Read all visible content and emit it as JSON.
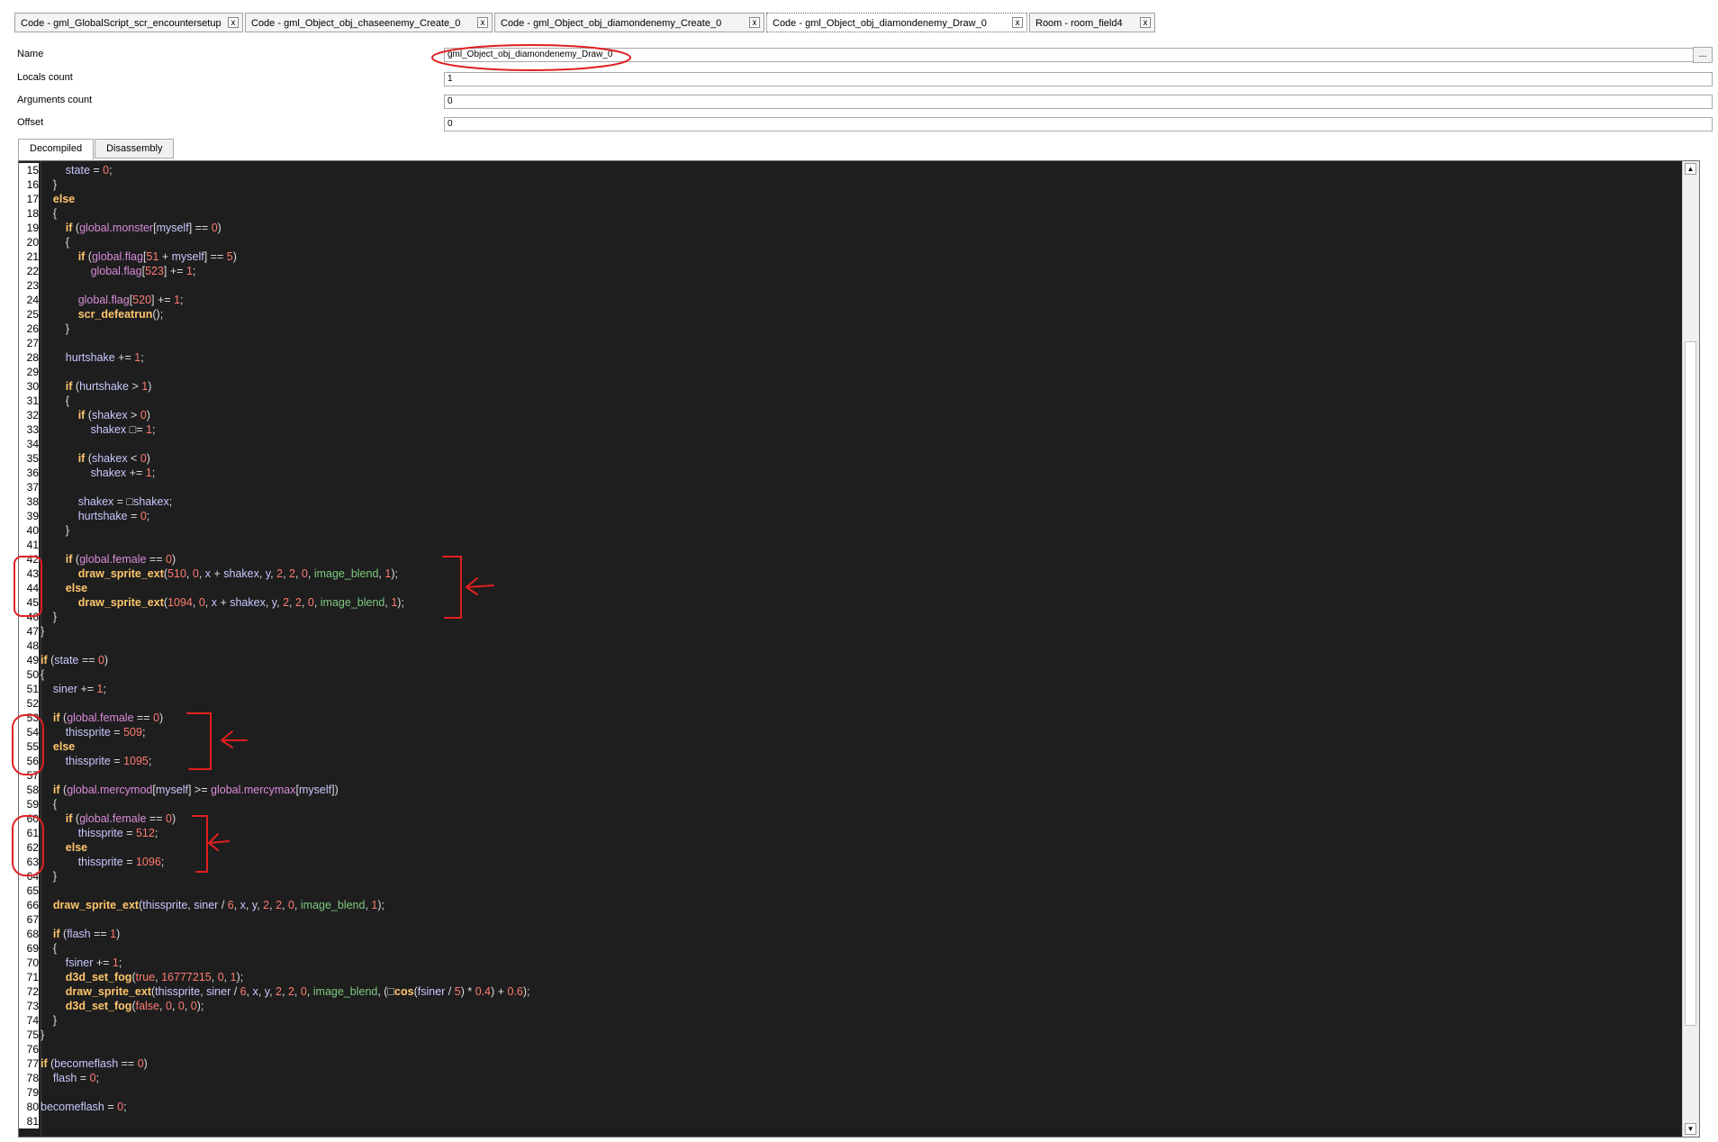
{
  "tabs": [
    {
      "label": "Code - gml_GlobalScript_scr_encountersetup",
      "close": "x",
      "width": 254
    },
    {
      "label": "Code - gml_Object_obj_chaseenemy_Create_0",
      "close": "x",
      "width": 275
    },
    {
      "label": "Code - gml_Object_obj_diamondenemy_Create_0",
      "close": "x",
      "width": 300
    },
    {
      "label": "Code - gml_Object_obj_diamondenemy_Draw_0",
      "close": "x",
      "width": 290,
      "active": true
    },
    {
      "label": "Room - room_field4",
      "close": "x",
      "width": 140
    }
  ],
  "properties": {
    "name_label": "Name",
    "name_value": "gml_Object_obj_diamondenemy_Draw_0",
    "browse_label": "...",
    "locals_label": "Locals count",
    "locals_value": "1",
    "arguments_label": "Arguments count",
    "arguments_value": "0",
    "offset_label": "Offset",
    "offset_value": "0"
  },
  "view_tabs": {
    "decompiled": "Decompiled",
    "disassembly": "Disassembly"
  },
  "code": {
    "lines": [
      {
        "n": "15",
        "html": "        <span class='id'>state</span> = <span class='num'>0</span>;"
      },
      {
        "n": "16",
        "html": "    }"
      },
      {
        "n": "17",
        "html": "    <span class='kw'>else</span>"
      },
      {
        "n": "18",
        "html": "    {"
      },
      {
        "n": "19",
        "html": "        <span class='kw'>if</span> (<span class='gv'>global.monster</span>[<span class='id'>myself</span>] == <span class='num'>0</span>)"
      },
      {
        "n": "20",
        "html": "        {"
      },
      {
        "n": "21",
        "html": "            <span class='kw'>if</span> (<span class='gv'>global.flag</span>[<span class='num'>51</span> + <span class='id'>myself</span>] == <span class='num'>5</span>)"
      },
      {
        "n": "22",
        "html": "                <span class='gv'>global.flag</span>[<span class='num'>523</span>] += <span class='num'>1</span>;"
      },
      {
        "n": "23",
        "html": ""
      },
      {
        "n": "24",
        "html": "            <span class='gv'>global.flag</span>[<span class='num'>520</span>] += <span class='num'>1</span>;"
      },
      {
        "n": "25",
        "html": "            <span class='fn'>scr_defeatrun</span>();"
      },
      {
        "n": "26",
        "html": "        }"
      },
      {
        "n": "27",
        "html": ""
      },
      {
        "n": "28",
        "html": "        <span class='id'>hurtshake</span> += <span class='num'>1</span>;"
      },
      {
        "n": "29",
        "html": ""
      },
      {
        "n": "30",
        "html": "        <span class='kw'>if</span> (<span class='id'>hurtshake</span> > <span class='num'>1</span>)"
      },
      {
        "n": "31",
        "html": "        {"
      },
      {
        "n": "32",
        "html": "            <span class='kw'>if</span> (<span class='id'>shakex</span> > <span class='num'>0</span>)"
      },
      {
        "n": "33",
        "html": "                <span class='id'>shakex</span> □= <span class='num'>1</span>;"
      },
      {
        "n": "34",
        "html": ""
      },
      {
        "n": "35",
        "html": "            <span class='kw'>if</span> (<span class='id'>shakex</span> < <span class='num'>0</span>)"
      },
      {
        "n": "36",
        "html": "                <span class='id'>shakex</span> += <span class='num'>1</span>;"
      },
      {
        "n": "37",
        "html": ""
      },
      {
        "n": "38",
        "html": "            <span class='id'>shakex</span> = □<span class='id'>shakex</span>;"
      },
      {
        "n": "39",
        "html": "            <span class='id'>hurtshake</span> = <span class='num'>0</span>;"
      },
      {
        "n": "40",
        "html": "        }"
      },
      {
        "n": "41",
        "html": ""
      },
      {
        "n": "42",
        "html": "        <span class='kw'>if</span> (<span class='gv'>global.female</span> == <span class='num'>0</span>)"
      },
      {
        "n": "43",
        "html": "            <span class='fn'>draw_sprite_ext</span>(<span class='num'>510</span>, <span class='num'>0</span>, <span class='id'>x</span> + <span class='id'>shakex</span>, <span class='id'>y</span>, <span class='num'>2</span>, <span class='num'>2</span>, <span class='num'>0</span>, <span class='bi'>image_blend</span>, <span class='num'>1</span>);"
      },
      {
        "n": "44",
        "html": "        <span class='kw'>else</span>"
      },
      {
        "n": "45",
        "html": "            <span class='fn'>draw_sprite_ext</span>(<span class='num'>1094</span>, <span class='num'>0</span>, <span class='id'>x</span> + <span class='id'>shakex</span>, <span class='id'>y</span>, <span class='num'>2</span>, <span class='num'>2</span>, <span class='num'>0</span>, <span class='bi'>image_blend</span>, <span class='num'>1</span>);"
      },
      {
        "n": "46",
        "html": "    }"
      },
      {
        "n": "47",
        "html": "}"
      },
      {
        "n": "48",
        "html": ""
      },
      {
        "n": "49",
        "html": "<span class='kw'>if</span> (<span class='id'>state</span> == <span class='num'>0</span>)"
      },
      {
        "n": "50",
        "html": "{"
      },
      {
        "n": "51",
        "html": "    <span class='id'>siner</span> += <span class='num'>1</span>;"
      },
      {
        "n": "52",
        "html": ""
      },
      {
        "n": "53",
        "html": "    <span class='kw'>if</span> (<span class='gv'>global.female</span> == <span class='num'>0</span>)"
      },
      {
        "n": "54",
        "html": "        <span class='id'>thissprite</span> = <span class='num'>509</span>;"
      },
      {
        "n": "55",
        "html": "    <span class='kw'>else</span>"
      },
      {
        "n": "56",
        "html": "        <span class='id'>thissprite</span> = <span class='num'>1095</span>;"
      },
      {
        "n": "57",
        "html": ""
      },
      {
        "n": "58",
        "html": "    <span class='kw'>if</span> (<span class='gv'>global.mercymod</span>[<span class='id'>myself</span>] >= <span class='gv'>global.mercymax</span>[<span class='id'>myself</span>])"
      },
      {
        "n": "59",
        "html": "    {"
      },
      {
        "n": "60",
        "html": "        <span class='kw'>if</span> (<span class='gv'>global.female</span> == <span class='num'>0</span>)"
      },
      {
        "n": "61",
        "html": "            <span class='id'>thissprite</span> = <span class='num'>512</span>;"
      },
      {
        "n": "62",
        "html": "        <span class='kw'>else</span>"
      },
      {
        "n": "63",
        "html": "            <span class='id'>thissprite</span> = <span class='num'>1096</span>;"
      },
      {
        "n": "64",
        "html": "    }"
      },
      {
        "n": "65",
        "html": ""
      },
      {
        "n": "66",
        "html": "    <span class='fn'>draw_sprite_ext</span>(<span class='id'>thissprite</span>, <span class='id'>siner</span> / <span class='num'>6</span>, <span class='id'>x</span>, <span class='id'>y</span>, <span class='num'>2</span>, <span class='num'>2</span>, <span class='num'>0</span>, <span class='bi'>image_blend</span>, <span class='num'>1</span>);"
      },
      {
        "n": "67",
        "html": ""
      },
      {
        "n": "68",
        "html": "    <span class='kw'>if</span> (<span class='id'>flash</span> == <span class='num'>1</span>)"
      },
      {
        "n": "69",
        "html": "    {"
      },
      {
        "n": "70",
        "html": "        <span class='id'>fsiner</span> += <span class='num'>1</span>;"
      },
      {
        "n": "71",
        "html": "        <span class='fn'>d3d_set_fog</span>(<span class='num'>true</span>, <span class='num'>16777215</span>, <span class='num'>0</span>, <span class='num'>1</span>);"
      },
      {
        "n": "72",
        "html": "        <span class='fn'>draw_sprite_ext</span>(<span class='id'>thissprite</span>, <span class='id'>siner</span> / <span class='num'>6</span>, <span class='id'>x</span>, <span class='id'>y</span>, <span class='num'>2</span>, <span class='num'>2</span>, <span class='num'>0</span>, <span class='bi'>image_blend</span>, (□<span class='fn'>cos</span>(<span class='id'>fsiner</span> / <span class='num'>5</span>) * <span class='num'>0.4</span>) + <span class='num'>0.6</span>);"
      },
      {
        "n": "73",
        "html": "        <span class='fn'>d3d_set_fog</span>(<span class='num'>false</span>, <span class='num'>0</span>, <span class='num'>0</span>, <span class='num'>0</span>);"
      },
      {
        "n": "74",
        "html": "    }"
      },
      {
        "n": "75",
        "html": "}"
      },
      {
        "n": "76",
        "html": ""
      },
      {
        "n": "77",
        "html": "<span class='kw'>if</span> (<span class='id'>becomeflash</span> == <span class='num'>0</span>)"
      },
      {
        "n": "78",
        "html": "    <span class='id'>flash</span> = <span class='num'>0</span>;"
      },
      {
        "n": "79",
        "html": ""
      },
      {
        "n": "80",
        "html": "<span class='id'>becomeflash</span> = <span class='num'>0</span>;"
      },
      {
        "n": "81",
        "html": ""
      }
    ]
  },
  "scrollbar": {
    "up": "▲",
    "down": "▼"
  },
  "colors": {
    "annotation": "#e02020",
    "editor_bg": "#1e1e1e"
  }
}
